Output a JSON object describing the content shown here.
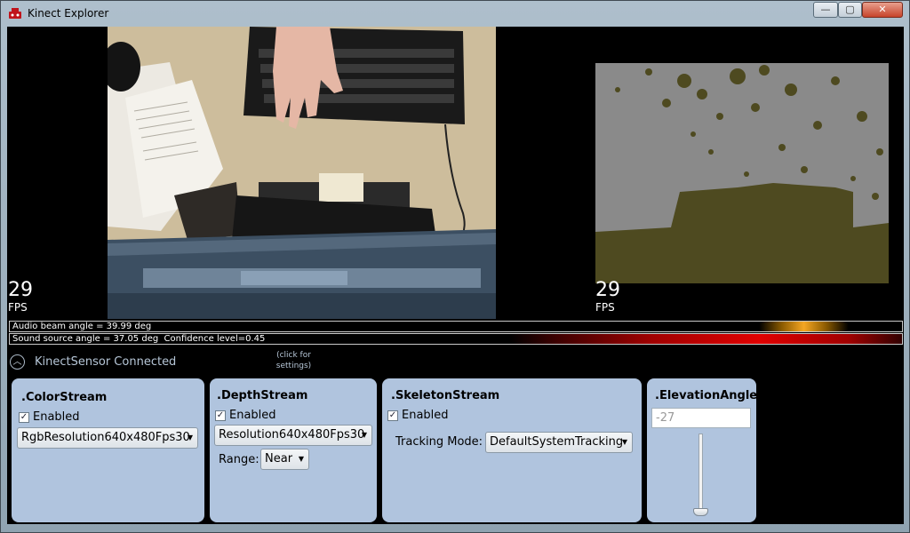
{
  "window": {
    "title": "Kinect Explorer",
    "min_glyph": "—",
    "max_glyph": "▢",
    "close_glyph": "✕"
  },
  "color_view": {
    "fps_value": "29",
    "fps_label": "FPS"
  },
  "depth_view": {
    "fps_value": "29",
    "fps_label": "FPS"
  },
  "audio": {
    "beam_text": "Audio beam angle = 39.99 deg",
    "source_text": "Sound source angle = 37.05 deg  Confidence level=0.45"
  },
  "sensor": {
    "status": "KinectSensor Connected",
    "hint": "(click for settings)"
  },
  "color_stream": {
    "title": ".ColorStream",
    "enabled_label": "Enabled",
    "enabled": true,
    "format": "RgbResolution640x480Fps30"
  },
  "depth_stream": {
    "title": ".DepthStream",
    "enabled_label": "Enabled",
    "enabled": true,
    "format": "Resolution640x480Fps30",
    "range_label": "Range:",
    "range_value": "Near"
  },
  "skeleton_stream": {
    "title": ".SkeletonStream",
    "enabled_label": "Enabled",
    "enabled": true,
    "tracking_label": "Tracking Mode:",
    "tracking_value": "DefaultSystemTracking"
  },
  "elevation": {
    "title": ".ElevationAngle",
    "value": "-27"
  },
  "colors": {
    "panel": "#b0c4de",
    "depth_floor": "#4e4a20",
    "depth_wall": "#8a8a8a",
    "status_text": "#b6c6d7"
  }
}
